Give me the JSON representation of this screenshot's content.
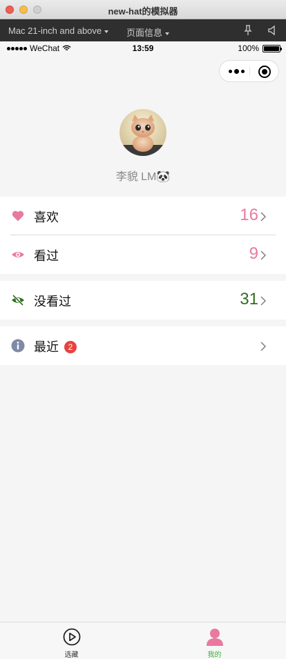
{
  "window": {
    "title": "new-hat的模拟器"
  },
  "toolbar": {
    "device": "Mac 21-inch and above",
    "page_info": "页面信息"
  },
  "statusbar": {
    "carrier": "WeChat",
    "time": "13:59",
    "battery": "100%"
  },
  "profile": {
    "name": "李貌 LM🐼"
  },
  "rows": {
    "like": {
      "label": "喜欢",
      "count": "16"
    },
    "watched": {
      "label": "看过",
      "count": "9"
    },
    "unwatched": {
      "label": "没看过",
      "count": "31"
    },
    "recent": {
      "label": "最近",
      "badge": "2"
    }
  },
  "tabs": [
    {
      "label": "选藏",
      "icon": "play-circle-icon"
    },
    {
      "label": "我的",
      "icon": "person-icon",
      "active": true
    }
  ],
  "colors": {
    "pink": "#e9799f",
    "green": "#2f6e1f",
    "tab_active": "#3cb034",
    "badge": "#e64340"
  }
}
